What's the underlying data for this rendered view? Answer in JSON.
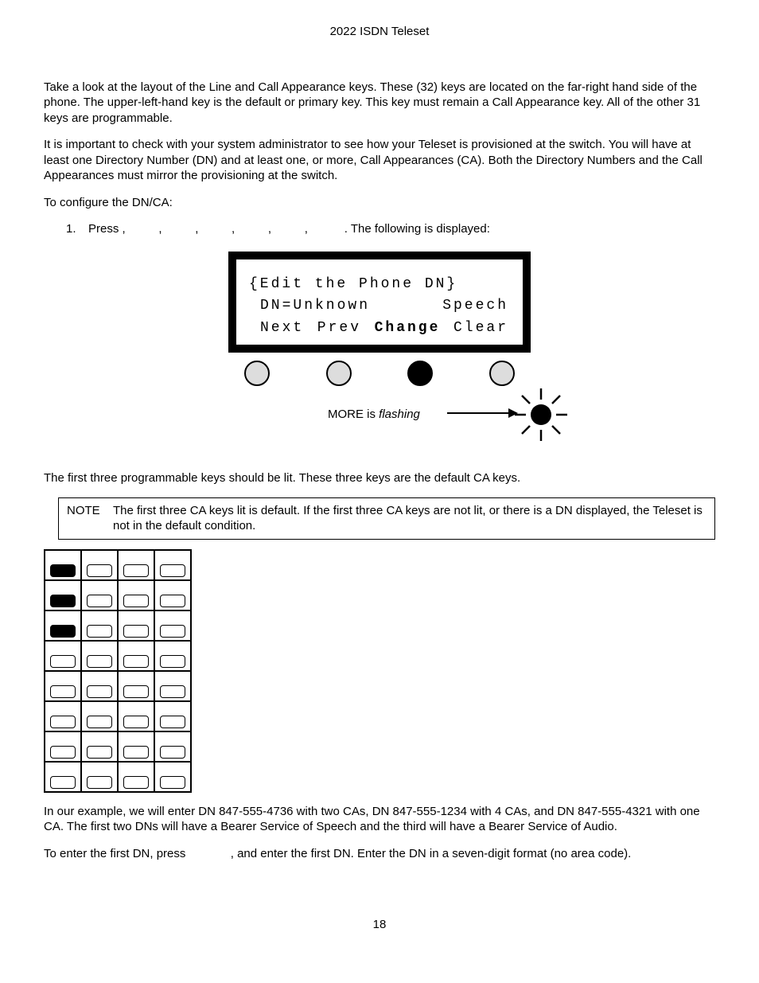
{
  "header": {
    "title": "2022 ISDN Teleset"
  },
  "para1": "Take a look at the layout of the Line and Call Appearance keys. These (32) keys are located on the far-right hand side of the phone. The upper-left-hand key is the default or primary key. This key must remain a Call Appearance key. All of the other 31 keys are programmable.",
  "para2": "It is important to check with your system administrator to see how your Teleset is provisioned at the switch. You will have at least one Directory Number (DN) and at least one, or more, Call Appearances (CA). Both the Directory Numbers and the Call Appearances must mirror the provisioning at the switch.",
  "para3": "To configure the DN/CA:",
  "step1_num": "1.",
  "step1_a": "Press",
  "step1_commas": ",          ,          ,          ,          ,          ,          ",
  "step1_b": ". The following is displayed:",
  "lcd": {
    "line1": "{Edit the Phone DN}",
    "line2_left": "DN=Unknown",
    "line2_right": "Speech",
    "softkeys": [
      "Next",
      "Prev",
      "Change",
      "Clear"
    ]
  },
  "flash": {
    "pre": "MORE is ",
    "em": "flashing"
  },
  "para4": "The first three programmable keys should be lit. These three keys are the default CA keys.",
  "note": {
    "label": "NOTE",
    "text": "The first three CA keys lit is default. If the first three CA keys are not lit, or there is a DN displayed, the Teleset is not in the default condition."
  },
  "keypad": {
    "rows": 8,
    "cols": 4,
    "lit": [
      [
        0,
        0
      ],
      [
        1,
        0
      ],
      [
        2,
        0
      ]
    ]
  },
  "para5": "In our example, we will enter DN 847-555-4736 with two CAs, DN 847-555-1234 with 4 CAs, and DN 847-555-4321 with one CA. The first two DNs will have a Bearer Service of Speech and the third will have a Bearer Service of Audio.",
  "para6_a": "To enter the first DN, press",
  "para6_b": ", and enter the first DN. Enter the DN in a seven-digit format (no area code).",
  "page": "18"
}
